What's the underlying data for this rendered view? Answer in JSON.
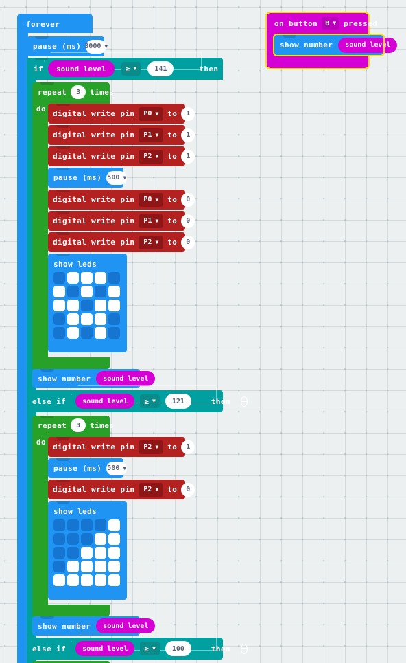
{
  "workspace": {
    "background_color": "#ecf0f1",
    "grid": "dotted"
  },
  "scripts": [
    {
      "name": "forever-loop",
      "hat_label": "forever",
      "color": "#2094f3"
    },
    {
      "name": "on-button-pressed",
      "hat_label_1": "on button",
      "button": "B",
      "hat_label_2": "pressed",
      "color": "#d400d4",
      "selected": true,
      "child": {
        "label": "show number",
        "value": "sound level"
      }
    }
  ],
  "blocks": {
    "forever": "forever",
    "pause_label": "pause (ms)",
    "pause_top_value": "3000",
    "pause_inner_value": "500",
    "if_label": "if",
    "else_if_label": "else if",
    "then_label": "then",
    "repeat_label": "repeat",
    "repeat_value": "3",
    "times_label": "times",
    "do_label": "do",
    "digital_write_label": "digital write pin",
    "to_label": "to",
    "show_leds_label": "show leds",
    "show_number_label": "show number",
    "sound_level_label": "sound level",
    "operator": "≥",
    "on_button_label": "on button",
    "pressed_label": "pressed",
    "button_value": "B"
  },
  "conditions": [
    {
      "reporter": "sound level",
      "op": "≥",
      "threshold": "141",
      "keyword": "if"
    },
    {
      "reporter": "sound level",
      "op": "≥",
      "threshold": "121",
      "keyword": "else if"
    },
    {
      "reporter": "sound level",
      "op": "≥",
      "threshold": "100",
      "keyword": "else if"
    }
  ],
  "branch_one": {
    "repeat_times": "3",
    "writes_high": [
      {
        "pin": "P0",
        "value": "1"
      },
      {
        "pin": "P1",
        "value": "1"
      },
      {
        "pin": "P2",
        "value": "1"
      }
    ],
    "pause": "500",
    "writes_low": [
      {
        "pin": "P0",
        "value": "0"
      },
      {
        "pin": "P1",
        "value": "0"
      },
      {
        "pin": "P2",
        "value": "0"
      }
    ],
    "leds": [
      [
        0,
        1,
        1,
        1,
        0
      ],
      [
        1,
        0,
        1,
        0,
        1
      ],
      [
        1,
        1,
        0,
        1,
        1
      ],
      [
        0,
        1,
        1,
        1,
        0
      ],
      [
        0,
        1,
        0,
        1,
        0
      ]
    ],
    "show_number": "sound level"
  },
  "branch_two": {
    "repeat_times": "3",
    "write_high": {
      "pin": "P2",
      "value": "1"
    },
    "pause": "500",
    "write_low": {
      "pin": "P2",
      "value": "0"
    },
    "leds": [
      [
        0,
        0,
        0,
        0,
        1
      ],
      [
        0,
        0,
        0,
        1,
        1
      ],
      [
        0,
        0,
        1,
        1,
        1
      ],
      [
        0,
        1,
        1,
        1,
        1
      ],
      [
        1,
        1,
        1,
        1,
        1
      ]
    ],
    "show_number": "sound level"
  },
  "colors": {
    "basic_blue": "#2094f3",
    "logic_teal": "#00a0a0",
    "loop_green": "#28a128",
    "pins_red": "#b32121",
    "input_magenta": "#d400d4",
    "selection_outline": "#ffdf00"
  }
}
